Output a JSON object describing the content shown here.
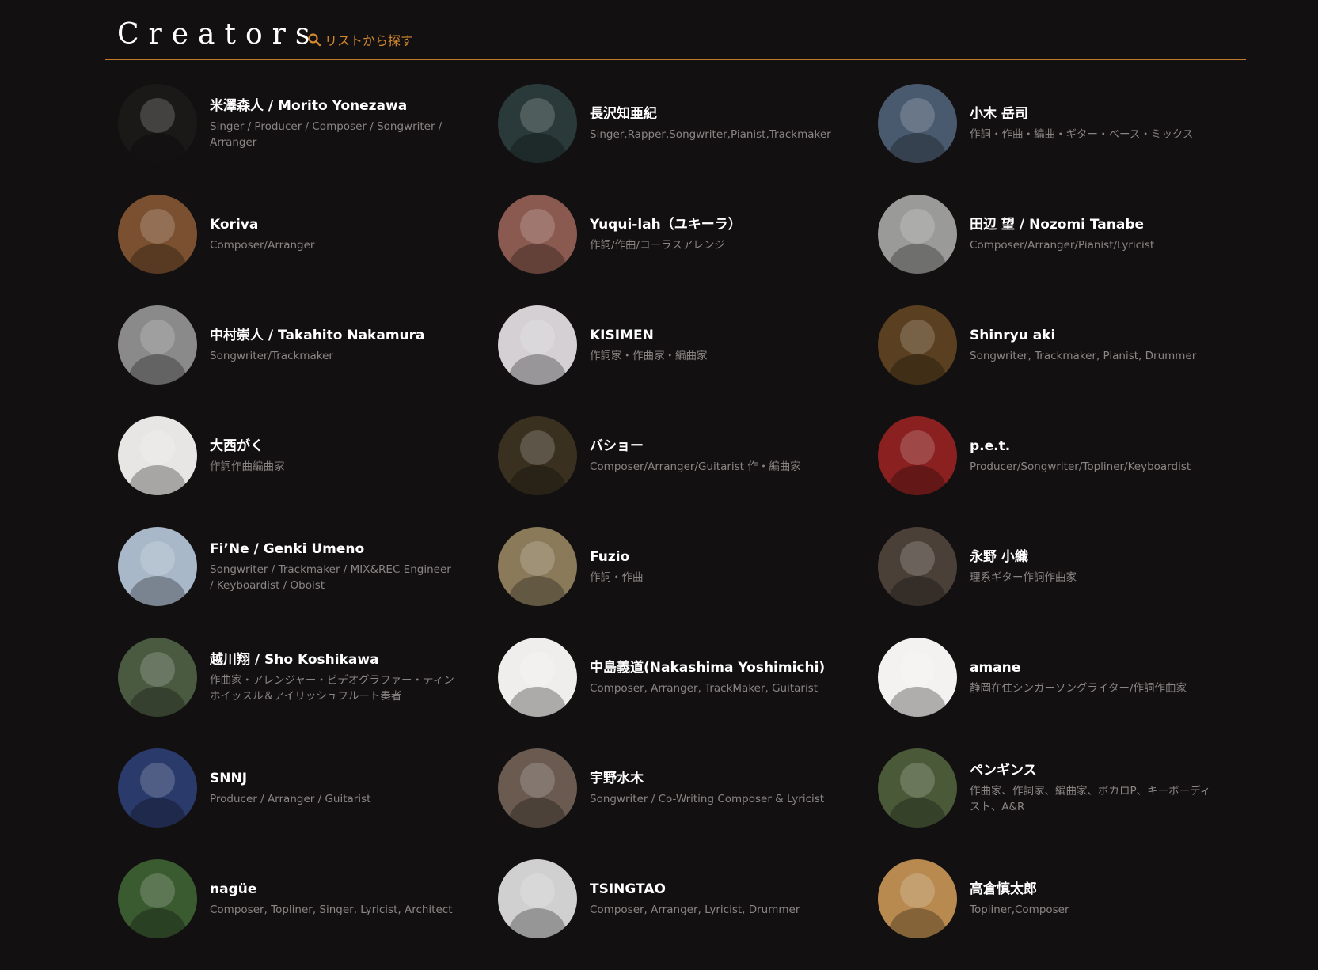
{
  "header": {
    "title": "Creators",
    "search_label": "リストから探す",
    "accent": "#d4892f"
  },
  "creators": [
    {
      "name": "米澤森人 / Morito Yonezawa",
      "role": "Singer / Producer / Composer / Songwriter / Arranger",
      "avatar_color": "#1b1818"
    },
    {
      "name": "長沢知亜紀",
      "role": "Singer,Rapper,Songwriter,Pianist,Trackmaker",
      "avatar_color": "#2a3a3a"
    },
    {
      "name": "小木 岳司",
      "role": "作詞・作曲・編曲・ギター・ベース・ミックス",
      "avatar_color": "#4a5a6e"
    },
    {
      "name": "Koriva",
      "role": "Composer/Arranger",
      "avatar_color": "#7a5030"
    },
    {
      "name": "Yuqui-lah（ユキーラ）",
      "role": "作詞/作曲/コーラスアレンジ",
      "avatar_color": "#8a5a50"
    },
    {
      "name": "田辺 望 / Nozomi Tanabe",
      "role": "Composer/Arranger/Pianist/Lyricist",
      "avatar_color": "#9a9a98"
    },
    {
      "name": "中村崇人 / Takahito Nakamura",
      "role": "Songwriter/Trackmaker",
      "avatar_color": "#8a8a8a"
    },
    {
      "name": "KISIMEN",
      "role": "作詞家・作曲家・編曲家",
      "avatar_color": "#d4d0d4"
    },
    {
      "name": "Shinryu aki",
      "role": "Songwriter, Trackmaker, Pianist, Drummer",
      "avatar_color": "#5a4020"
    },
    {
      "name": "大西がく",
      "role": "作詞作曲編曲家",
      "avatar_color": "#e8e6e4"
    },
    {
      "name": "バショー",
      "role": "Composer/Arranger/Guitarist 作・編曲家",
      "avatar_color": "#3a3020"
    },
    {
      "name": "p.e.t.",
      "role": "Producer/Songwriter/Topliner/Keyboardist",
      "avatar_color": "#8a2020"
    },
    {
      "name": "Fi’Ne / Genki Umeno",
      "role": "Songwriter / Trackmaker / MIX&REC Engineer / Keyboardist / Oboist",
      "avatar_color": "#a8b8c8"
    },
    {
      "name": "Fuzio",
      "role": "作詞・作曲",
      "avatar_color": "#8a7a5a"
    },
    {
      "name": "永野 小織",
      "role": "理系ギター作詞作曲家",
      "avatar_color": "#4a4038"
    },
    {
      "name": "越川翔 / Sho Koshikawa",
      "role": "作曲家・アレンジャー・ビデオグラファー・ティンホイッスル＆アイリッシュフルート奏者",
      "avatar_color": "#4a5a40"
    },
    {
      "name": "中島義道(Nakashima Yoshimichi)",
      "role": "Composer, Arranger, TrackMaker, Guitarist",
      "avatar_color": "#f0eeec"
    },
    {
      "name": "amane",
      "role": "静岡在住シンガーソングライター/作詞作曲家",
      "avatar_color": "#f4f2f0"
    },
    {
      "name": "SNNJ",
      "role": "Producer / Arranger / Guitarist",
      "avatar_color": "#2a3a6a"
    },
    {
      "name": "宇野水木",
      "role": "Songwriter / Co-Writing Composer & Lyricist",
      "avatar_color": "#6a5a50"
    },
    {
      "name": "ペンギンス",
      "role": "作曲家、作詞家、編曲家、ボカロP、キーボーディスト、A&R",
      "avatar_color": "#4a5a38"
    },
    {
      "name": "nagüe",
      "role": "Composer, Topliner, Singer, Lyricist, Architect",
      "avatar_color": "#3a5a30"
    },
    {
      "name": "TSINGTAO",
      "role": "Composer, Arranger, Lyricist, Drummer",
      "avatar_color": "#d0d0d0"
    },
    {
      "name": "高倉慎太郎",
      "role": "Topliner,Composer",
      "avatar_color": "#b88a50"
    }
  ]
}
